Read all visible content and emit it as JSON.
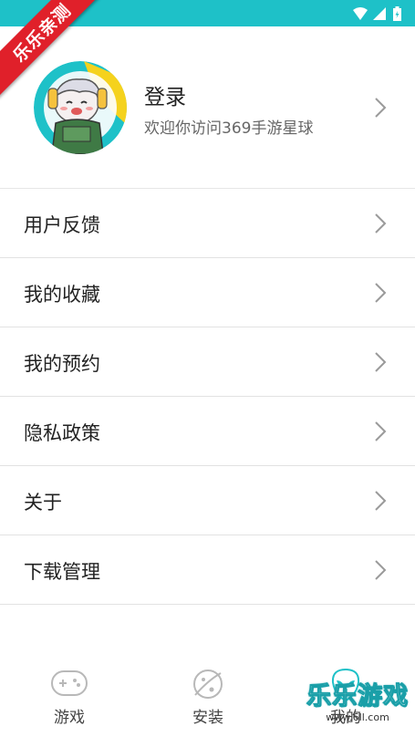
{
  "colors": {
    "accent": "#1ec1c8",
    "ribbon": "#e0202a",
    "divider": "#e2e2e2"
  },
  "ribbon": {
    "text": "乐乐亲测"
  },
  "status_bar": {
    "icons": [
      "wifi-icon",
      "signal-icon",
      "battery-charging-icon"
    ]
  },
  "profile": {
    "title": "登录",
    "subtitle": "欢迎你访问369手游星球",
    "avatar_icon": "cartoon-avatar"
  },
  "menu": {
    "items": [
      {
        "label": "用户反馈"
      },
      {
        "label": "我的收藏"
      },
      {
        "label": "我的预约"
      },
      {
        "label": "隐私政策"
      },
      {
        "label": "关于"
      },
      {
        "label": "下载管理"
      }
    ]
  },
  "tabs": [
    {
      "label": "游戏",
      "icon": "gamepad-icon",
      "active": false
    },
    {
      "label": "安装",
      "icon": "planet-icon",
      "active": false
    },
    {
      "label": "我的",
      "icon": "alien-icon",
      "active": true
    }
  ],
  "watermark": {
    "main": "乐乐游戏",
    "sub": "www.6ll.com"
  }
}
